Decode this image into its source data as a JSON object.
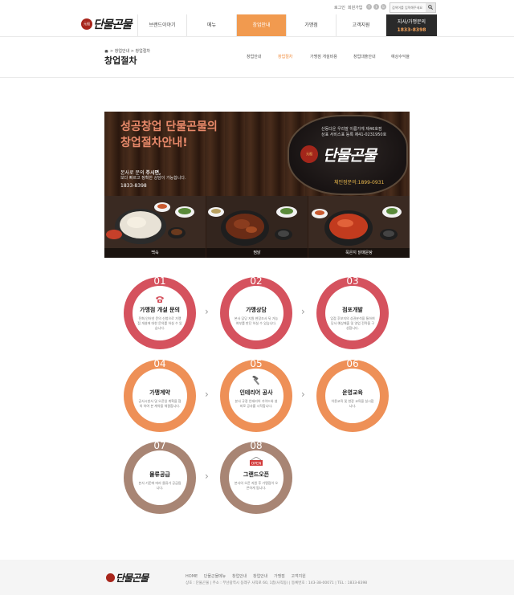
{
  "util": {
    "login": "로그인",
    "join": "회원가입",
    "sns": [
      "f",
      "t",
      "b"
    ],
    "search_placeholder": "검색어를 입력해주세요"
  },
  "logo": {
    "seal": "元祖",
    "name": "단물곤물"
  },
  "gnb": {
    "items": [
      "브랜드이야기",
      "메뉴",
      "창업안내",
      "가맹점",
      "고객지원"
    ],
    "active_index": 2,
    "franchise_title": "지사/가맹문의",
    "franchise_phone": "1833-8398"
  },
  "sub": {
    "breadcrumb": "> 창업안내 > 창업절차",
    "title": "창업절차",
    "tabs": [
      "창업안내",
      "창업절차",
      "가맹점 개설비용",
      "창업대출안내",
      "예상수익율"
    ],
    "active_tab": 1
  },
  "banner": {
    "headline1": "성공창업 단물곤물의",
    "headline2": "창업절차안내!",
    "desc_prefix": "본사로 문의 ",
    "desc_bold": "주시면,",
    "desc2": "보다 빠르고 정확한 상담이 가능합니다.",
    "phone": "1833-8398",
    "sign_line1": "산동다운 우리말 이름가게 제46호점",
    "sign_line2": "상표 서비스표 등록 제41-0231950호",
    "sign_seal": "元祖",
    "sign_brand": "단물곤물",
    "sign_tel": "체인점문의:1899-0931",
    "foods": [
      "백숙",
      "찜닭",
      "묵은지 닭매운탕"
    ]
  },
  "steps": [
    {
      "num": "01",
      "title": "가맹점 개설 문의",
      "desc": "전화,인터넷 문의 신청으로 가맹점 개설에 대한 문의를 하실 수 있습니다.",
      "color": "red",
      "icon": "telephone-icon"
    },
    {
      "num": "02",
      "title": "가맹상담",
      "desc": "본사 담당 지원 현장조사 뒤 가능 여부를 판단 하실 수 있습니다.",
      "color": "red",
      "icon": ""
    },
    {
      "num": "03",
      "title": "점포개발",
      "desc": "입점 후보지의 상권분석을 통하여 당사 예상매출 및 영업 전략을 구성합니다.",
      "color": "red",
      "icon": ""
    },
    {
      "num": "04",
      "title": "가맹계약",
      "desc": "공사시방서 및 오픈일 계획을 협의 하여 본 계약을 체결합니다.",
      "color": "orange",
      "icon": ""
    },
    {
      "num": "05",
      "title": "인테리어 공사",
      "desc": "본사 규정 인테리어 가이드와 설비로 공사를 시작합니다.",
      "color": "orange",
      "icon": "hammer-icon"
    },
    {
      "num": "06",
      "title": "운영교육",
      "desc": "이론교육 및 현장 교육을 실시합니다.",
      "color": "orange",
      "icon": ""
    },
    {
      "num": "07",
      "title": "물류공급",
      "desc": "본사 기준에 따라 물류가 공급됩니다.",
      "color": "brown",
      "icon": ""
    },
    {
      "num": "08",
      "title": "그랜드오픈",
      "desc": "본사의 오픈 지원 후 가맹점이 오픈하게 됩니다.",
      "color": "brown",
      "icon": "open-sign-icon",
      "badge": "OPEN"
    }
  ],
  "footer": {
    "nav": [
      "HOME",
      "단물곤물메뉴",
      "창업안내",
      "창업안내",
      "가맹점",
      "고객지원"
    ],
    "address": "상호 : 단물곤물 | 주소 : 부산광역시 동래구 사직로 60, 1층(사직동) | 등록번호 : 143-38-00071 | TEL : 1833-8398"
  },
  "colors": {
    "accent": "#f19a4f",
    "red": "#d5525e",
    "orange": "#ee9057",
    "brown": "#a88574"
  }
}
